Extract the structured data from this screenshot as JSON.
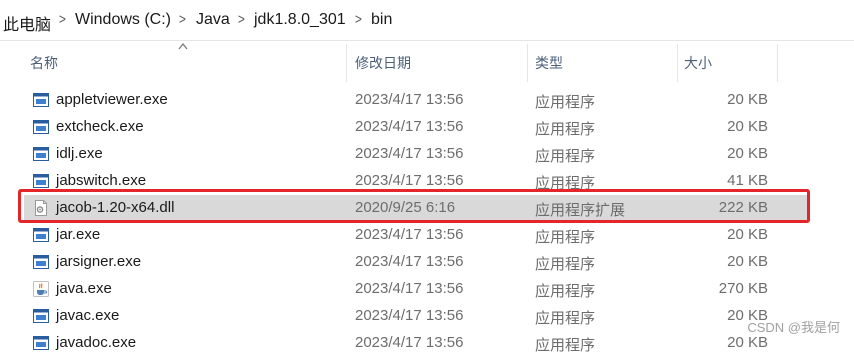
{
  "breadcrumb": [
    "此电脑",
    "Windows (C:)",
    "Java",
    "jdk1.8.0_301",
    "bin"
  ],
  "columns": {
    "name": "名称",
    "date": "修改日期",
    "type": "类型",
    "size": "大小"
  },
  "files": [
    {
      "name": "appletviewer.exe",
      "date": "2023/4/17 13:56",
      "type": "应用程序",
      "size": "20 KB",
      "icon": "exe-window-icon"
    },
    {
      "name": "extcheck.exe",
      "date": "2023/4/17 13:56",
      "type": "应用程序",
      "size": "20 KB",
      "icon": "exe-window-icon"
    },
    {
      "name": "idlj.exe",
      "date": "2023/4/17 13:56",
      "type": "应用程序",
      "size": "20 KB",
      "icon": "exe-window-icon"
    },
    {
      "name": "jabswitch.exe",
      "date": "2023/4/17 13:56",
      "type": "应用程序",
      "size": "41 KB",
      "icon": "exe-window-icon"
    },
    {
      "name": "jacob-1.20-x64.dll",
      "date": "2020/9/25 6:16",
      "type": "应用程序扩展",
      "size": "222 KB",
      "icon": "dll-gear-icon",
      "selected": true
    },
    {
      "name": "jar.exe",
      "date": "2023/4/17 13:56",
      "type": "应用程序",
      "size": "20 KB",
      "icon": "exe-window-icon"
    },
    {
      "name": "jarsigner.exe",
      "date": "2023/4/17 13:56",
      "type": "应用程序",
      "size": "20 KB",
      "icon": "exe-window-icon"
    },
    {
      "name": "java.exe",
      "date": "2023/4/17 13:56",
      "type": "应用程序",
      "size": "270 KB",
      "icon": "java-cup-icon"
    },
    {
      "name": "javac.exe",
      "date": "2023/4/17 13:56",
      "type": "应用程序",
      "size": "20 KB",
      "icon": "exe-window-icon"
    },
    {
      "name": "javadoc.exe",
      "date": "2023/4/17 13:56",
      "type": "应用程序",
      "size": "20 KB",
      "icon": "exe-window-icon"
    }
  ],
  "watermark": "CSDN @我是何",
  "colors": {
    "highlight_border": "#e4262a",
    "selected_row": "#d9d9d9",
    "header_text": "#4c607a"
  }
}
